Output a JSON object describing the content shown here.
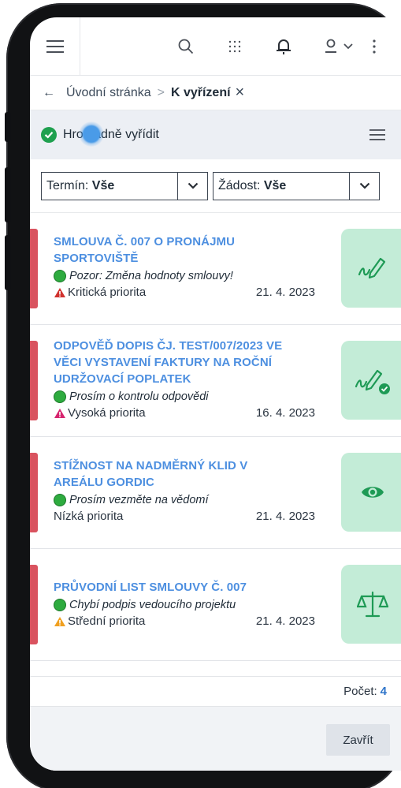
{
  "breadcrumb": {
    "back_arrow": "←",
    "home": "Úvodní stránka",
    "separator": ">",
    "current": "K vyřízení",
    "close": "×"
  },
  "action_bar": {
    "bulk_resolve": "Hromadně vyřídit"
  },
  "filters": {
    "term": {
      "label": "Termín:",
      "value": "Vše"
    },
    "request": {
      "label": "Žádost:",
      "value": "Vše"
    }
  },
  "items": [
    {
      "title_line1": "SMLOUVA Č. 007 O PRONÁJMU",
      "title_line2": "SPORTOVIŠTĚ",
      "title_line3": "",
      "note": "Pozor: Změna hodnoty smlouvy!",
      "priority": "Kritická priorita",
      "date": "21. 4. 2023",
      "action_icon": "sign-icon",
      "warn_color": "#d0312d"
    },
    {
      "title_line1": "ODPOVĚĎ DOPIS ČJ. TEST/007/2023 VE",
      "title_line2": "VĚCI VYSTAVENÍ FAKTURY NA ROČNÍ",
      "title_line3": "UDRŽOVACÍ POPLATEK",
      "note": "Prosím o kontrolu odpovědi",
      "priority": "Vysoká priorita",
      "date": "16. 4. 2023",
      "action_icon": "sign-approve-icon",
      "warn_color": "#d6246e"
    },
    {
      "title_line1": "STÍŽNOST NA NADMĚRNÝ KLID V",
      "title_line2": "AREÁLU GORDIC",
      "title_line3": "",
      "note": "Prosím vezměte na vědomí",
      "priority": "Nízká priorita",
      "date": "21. 4. 2023",
      "action_icon": "eye-icon",
      "warn_color": ""
    },
    {
      "title_line1": "PRŮVODNÍ LIST SMLOUVY Č. 007",
      "title_line2": "",
      "title_line3": "",
      "note": "Chybí podpis vedoucího projektu",
      "priority": "Střední priorita",
      "date": "21. 4. 2023",
      "action_icon": "scales-icon",
      "warn_color": "#f0a020"
    }
  ],
  "footer": {
    "count_label": "Počet:",
    "count_value": "4",
    "close_button": "Zavřít"
  },
  "colors": {
    "accent_title": "#4d8fe0",
    "priority_bar": "#d9535f",
    "tile_bg": "#c3ecd7",
    "tile_icon": "#1e9a55",
    "status_dot": "#2eab3f"
  }
}
